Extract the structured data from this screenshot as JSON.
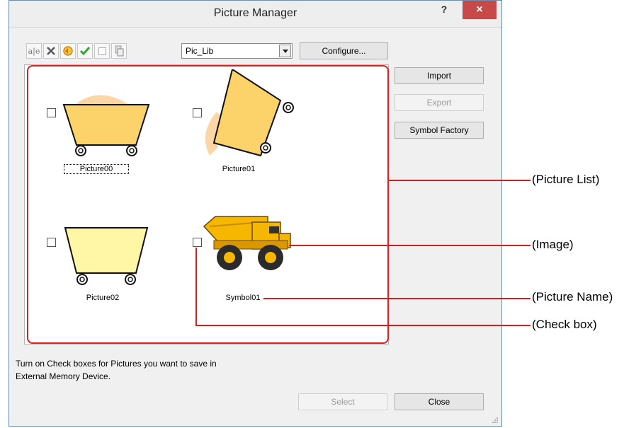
{
  "window": {
    "title": "Picture Manager",
    "help_label": "?",
    "close_label": "×"
  },
  "toolbar": {
    "icons": [
      "rename-icon",
      "delete-icon",
      "refresh-icon",
      "check-icon",
      "uncheck-icon",
      "copy-icon"
    ],
    "library_value": "Pic_Lib",
    "configure_label": "Configure..."
  },
  "side_buttons": {
    "import": "Import",
    "export": "Export",
    "symbol_factory": "Symbol Factory"
  },
  "pictures": [
    {
      "name": "Picture00",
      "checked": false,
      "focused": true
    },
    {
      "name": "Picture01",
      "checked": false,
      "focused": false
    },
    {
      "name": "Picture02",
      "checked": false,
      "focused": false
    },
    {
      "name": "Symbol01",
      "checked": false,
      "focused": false
    }
  ],
  "instruction": {
    "line1": "Turn on Check boxes for Pictures you want to save in",
    "line2": "External Memory Device."
  },
  "bottom_buttons": {
    "select": "Select",
    "close": "Close"
  },
  "annotations": {
    "picture_list": "(Picture List)",
    "image": "(Image)",
    "picture_name": "(Picture Name)",
    "check_box": "(Check box)"
  },
  "colors": {
    "annotation_red": "#e21d1d",
    "title_close_bg": "#c74a4a",
    "cart_fill": "#fcd36b",
    "cart_light": "#fff7a6"
  }
}
